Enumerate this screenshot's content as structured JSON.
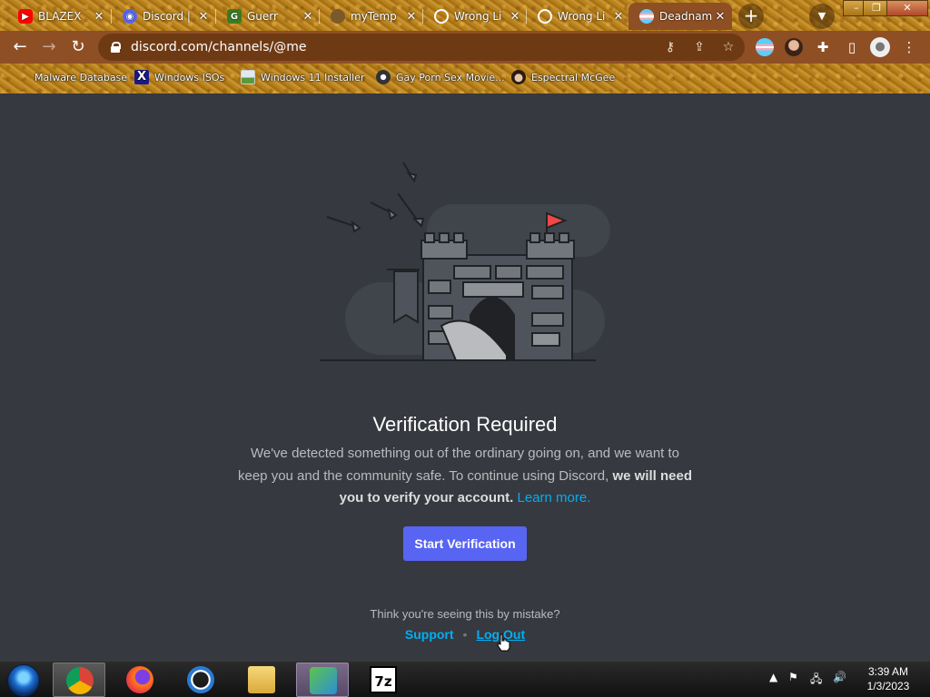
{
  "browser": {
    "tabs": [
      {
        "title": "BLAZEX",
        "favicon": "youtube-icon",
        "color": "#ff0000"
      },
      {
        "title": "Discord |",
        "favicon": "discord-icon",
        "color": "#5865f2"
      },
      {
        "title": "Guerr",
        "favicon": "guerrilla-mail-icon",
        "color": "#3a7d1e"
      },
      {
        "title": "myTemp",
        "favicon": "mytemp-icon",
        "color": "#7a5a2a"
      },
      {
        "title": "Wrong Li",
        "favicon": "globe-icon",
        "color": "#ffffff"
      },
      {
        "title": "Wrong Li",
        "favicon": "globe-icon",
        "color": "#ffffff"
      },
      {
        "title": "Deadnam",
        "favicon": "trans-flag-icon",
        "color": "#f5a9b8"
      }
    ],
    "url": "discord.com/channels/@me",
    "bookmarks": [
      {
        "label": "Malware Database",
        "icon": "none"
      },
      {
        "label": "Windows ISOs",
        "icon": "x-icon"
      },
      {
        "label": "Windows 11 Installer",
        "icon": "image-icon"
      },
      {
        "label": "Gay Porn Sex Movie...",
        "icon": "film-icon"
      },
      {
        "label": "Espectral McGee",
        "icon": "avatar-icon"
      }
    ]
  },
  "verification": {
    "title": "Verification Required",
    "body_lead": "We've detected something out of the ordinary going on, and we want to keep you and the community safe. To continue using Discord,",
    "body_bold": "we will need you to verify your account.",
    "learn_more": "Learn more.",
    "button": "Start Verification",
    "mistake": "Think you're seeing this by mistake?",
    "support": "Support",
    "logout": "Log Out"
  },
  "taskbar": {
    "time": "3:39 AM",
    "date": "1/3/2023",
    "seven_zip_label": "7z"
  },
  "colors": {
    "page_bg": "#36393f",
    "blurple": "#5865f2",
    "link": "#00aff4"
  }
}
